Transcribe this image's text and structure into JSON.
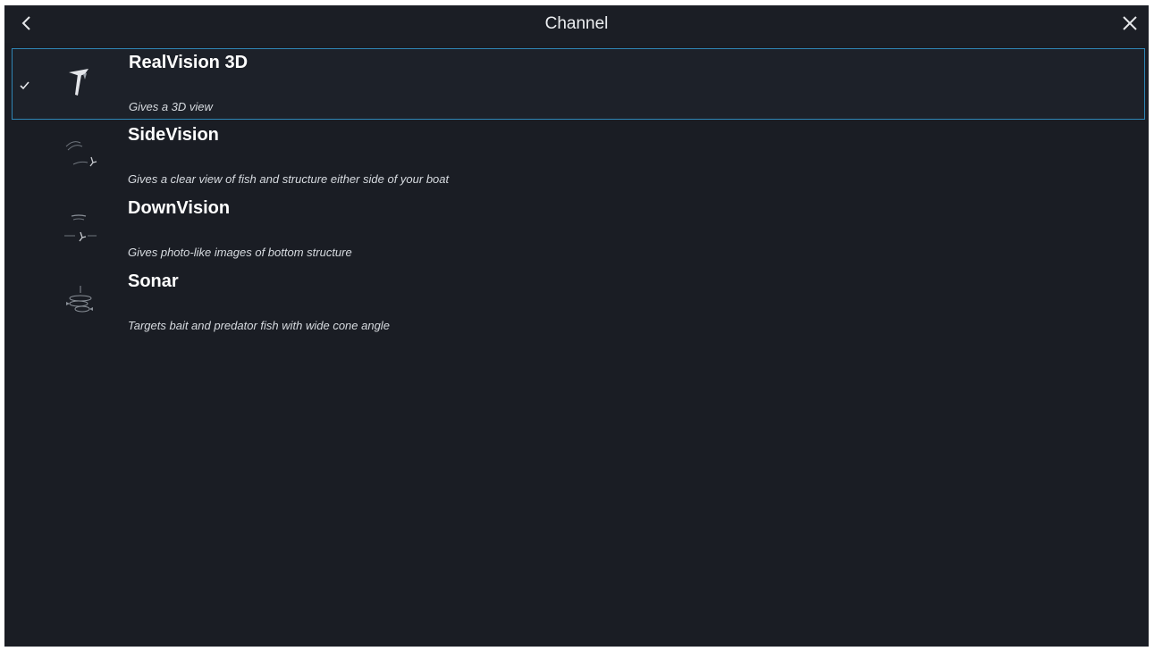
{
  "header": {
    "title": "Channel",
    "back_icon": "chevron-left-icon",
    "close_icon": "close-icon"
  },
  "channels": [
    {
      "name": "RealVision 3D",
      "description": "Gives a 3D view",
      "icon": "realvision-transducer-icon",
      "selected": true
    },
    {
      "name": "SideVision",
      "description": "Gives a clear view of fish and structure either side of your boat",
      "icon": "sidevision-icon",
      "selected": false
    },
    {
      "name": "DownVision",
      "description": "Gives photo-like images of bottom structure",
      "icon": "downvision-icon",
      "selected": false
    },
    {
      "name": "Sonar",
      "description": "Targets bait and predator fish with wide cone angle",
      "icon": "sonar-icon",
      "selected": false
    }
  ],
  "colors": {
    "background": "#1a1d24",
    "selection_border": "#2f86b5",
    "text": "#ffffff"
  }
}
